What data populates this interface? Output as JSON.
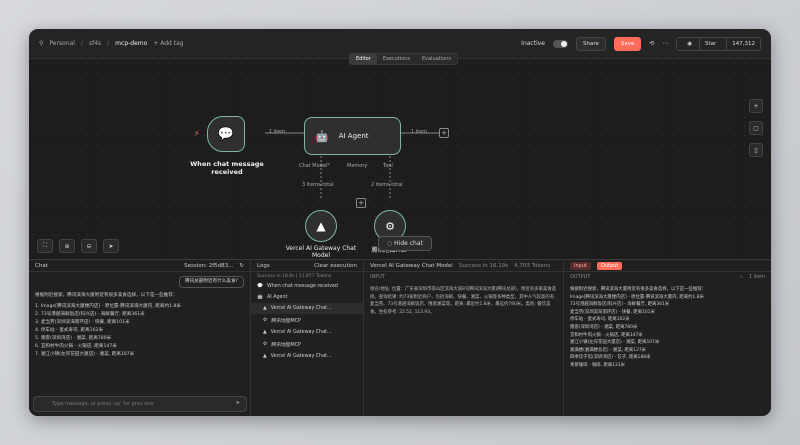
{
  "header": {
    "breadcrumb": [
      "Personal",
      "/",
      "sf4s",
      "/",
      "mcp-demo"
    ],
    "add_tag": "+ Add tag",
    "inactive": "Inactive",
    "share": "Share",
    "save": "Save",
    "github_star": "Star",
    "github_count": "147,312"
  },
  "tabs": [
    "Editor",
    "Executions",
    "Evaluations"
  ],
  "canvas": {
    "trigger_label": "When chat message received",
    "agent_label": "AI Agent",
    "items_1": "1 item",
    "items_2": "1 item",
    "port_chat": "Chat Model*",
    "port_memory": "Memory",
    "port_tool": "Tool",
    "sub_items": "3 items total",
    "sub_items2": "2 items total",
    "model_label": "Vercel AI Gateway Chat Model",
    "tool_label": "腾讯地图MCP",
    "hide_chat": "Hide chat"
  },
  "chat": {
    "title": "Chat",
    "session": "Session: 2f5d83...",
    "user_msg": "腾讯总部附近有什么美食?",
    "reply_intro": "根据附近搜索，腾讯滨海大厦附近有很多美食选择，以下是一些推荐：",
    "items": [
      "1. Image[腾讯滨海大厦楼内店] - 原位置-腾讯滨海大厦内, 距离约1.8米",
      "2. 73号港越海鲜饭店(科兴店) - 海鲜餐厅, 距离361米",
      "3. 麦当劳(深圳滨海南环店) - 快餐, 距离101米",
      "4. 停车站 - 蛋式寿司, 距离162米",
      "5. 隆客(深圳湾店) - 湘菜, 距离780米",
      "6. 宜和村牛肉火锅 - 火锅店, 距离147米",
      "7. 湘江小镇(左岸花园大厦店) - 湘菜, 距离107米"
    ],
    "placeholder": "Type message, or press 'up' for prev one"
  },
  "logs": {
    "title": "Logs",
    "success": "Success in 18.6s",
    "tokens": "11,877 Tokens",
    "clear": "Clear execution",
    "entries": [
      "When chat message received",
      "AI Agent",
      "Vercel AI Gateway Chat...",
      "腾讯地图MCP",
      "Vercel AI Gateway Chat...",
      "腾讯地图MCP",
      "Vercel AI Gateway Chat..."
    ]
  },
  "input": {
    "node_title": "Vercel AI Gateway Chat Model",
    "status": "Success in 16.19s",
    "tokens": "4,703 Tokens",
    "header": "INPUT",
    "badge_input": "Input",
    "badge_output": "Output",
    "text": "地名/地址: 位置：广东省深圳市南山区滨海大道8号腾讯滨海大厦(腾讯总部)，附近有多家美食选择。查询结果: 约73家附近商户，包括海鲜、快餐、湘菜、火锅等多种类型，其中人气较高的有麦当劳、73号港越海鲜饭店、隆客湘菜等。距离: 最近约1.8米，最远约780米。类别: 餐饮美食。坐标参考: 22.52, 113.93。"
  },
  "output": {
    "header": "OUTPUT",
    "items_label": "1 item",
    "intro": "根据附近搜索，腾讯滨海大厦附近有很多美食选择，以下是一些推荐：",
    "items": [
      "Image[腾讯滨海大厦楼内店] - 原位置-腾讯滨海大厦内, 距离约1.8米",
      "73号港越海鲜饭店(科兴店) - 海鲜餐厅, 距离361米",
      "麦当劳(深圳滨海南环店) - 快餐, 距离101米",
      "停车站 - 蛋式寿司, 距离162米",
      "隆客(深圳湾店) - 湘菜, 距离780米",
      "宜和村牛肉火锅 - 火锅店, 距离147米",
      "湘江小镇(左岸花园大厦店) - 湘菜, 距离107米",
      "湘满楼(湘满楼总店) - 湘菜, 距离127米",
      "四季饺子馆(深圳湾店) - 饺子, 距离188米",
      "青葱咖啡 - 咖啡, 距离121米"
    ]
  }
}
